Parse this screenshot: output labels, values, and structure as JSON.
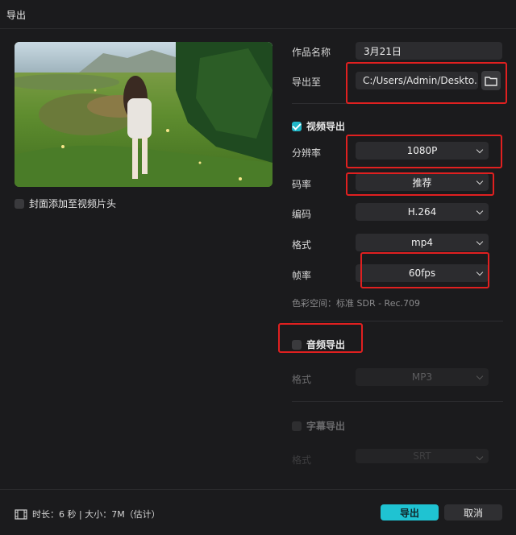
{
  "window": {
    "title": "导出"
  },
  "preview": {
    "cover_option_label": "封面添加至视频片头",
    "cover_option_checked": false
  },
  "work_name": {
    "label": "作品名称",
    "value": "3月21日"
  },
  "export_to": {
    "label": "导出至",
    "value": "C:/Users/Admin/Deskto..."
  },
  "video_export": {
    "label": "视频导出",
    "checked": true,
    "resolution": {
      "label": "分辨率",
      "value": "1080P"
    },
    "bitrate": {
      "label": "码率",
      "value": "推荐"
    },
    "codec": {
      "label": "编码",
      "value": "H.264"
    },
    "format": {
      "label": "格式",
      "value": "mp4"
    },
    "framerate": {
      "label": "帧率",
      "value": "60fps"
    },
    "colorspace": "色彩空间：标准 SDR - Rec.709"
  },
  "audio_export": {
    "label": "音频导出",
    "checked": false,
    "format": {
      "label": "格式",
      "value": "MP3"
    }
  },
  "subtitle_export": {
    "label": "字幕导出",
    "checked": false,
    "format": {
      "label": "格式",
      "value": "SRT"
    }
  },
  "footer": {
    "info": "时长：6 秒 | 大小：7M（估计）",
    "export_button": "导出",
    "cancel_button": "取消"
  },
  "colors": {
    "accent": "#1fc3d2",
    "highlight": "#e02020",
    "background": "#1b1b1d"
  }
}
